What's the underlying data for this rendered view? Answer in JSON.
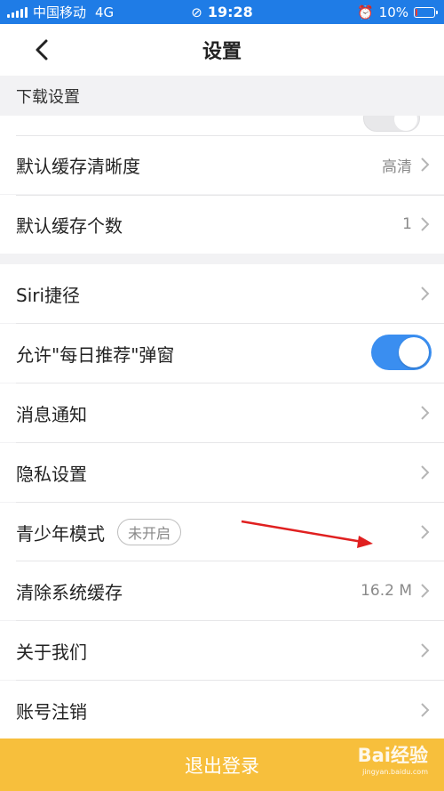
{
  "status_bar": {
    "carrier": "中国移动",
    "network": "4G",
    "time": "19:28",
    "battery": "10%",
    "battery_level": 0.1
  },
  "nav": {
    "title": "设置"
  },
  "section": {
    "download_header": "下载设置"
  },
  "download_rows": [
    {
      "label": "默认缓存清晰度",
      "value": "高清"
    },
    {
      "label": "默认缓存个数",
      "value": "1"
    }
  ],
  "general_rows": [
    {
      "label": "Siri捷径"
    },
    {
      "label": "允许\"每日推荐\"弹窗",
      "toggle": true
    },
    {
      "label": "消息通知"
    },
    {
      "label": "隐私设置"
    },
    {
      "label": "青少年模式",
      "badge": "未开启"
    },
    {
      "label": "清除系统缓存",
      "value": "16.2 M"
    },
    {
      "label": "关于我们"
    },
    {
      "label": "账号注销"
    }
  ],
  "logout": {
    "label": "退出登录"
  },
  "watermark": {
    "brand": "Bai经验",
    "url": "jingyan.baidu.com"
  },
  "colors": {
    "status_bar": "#1f7ce6",
    "toggle_on": "#3a8ef0",
    "logout_bg": "#f7bf3c",
    "annotation_arrow": "#e02020"
  }
}
